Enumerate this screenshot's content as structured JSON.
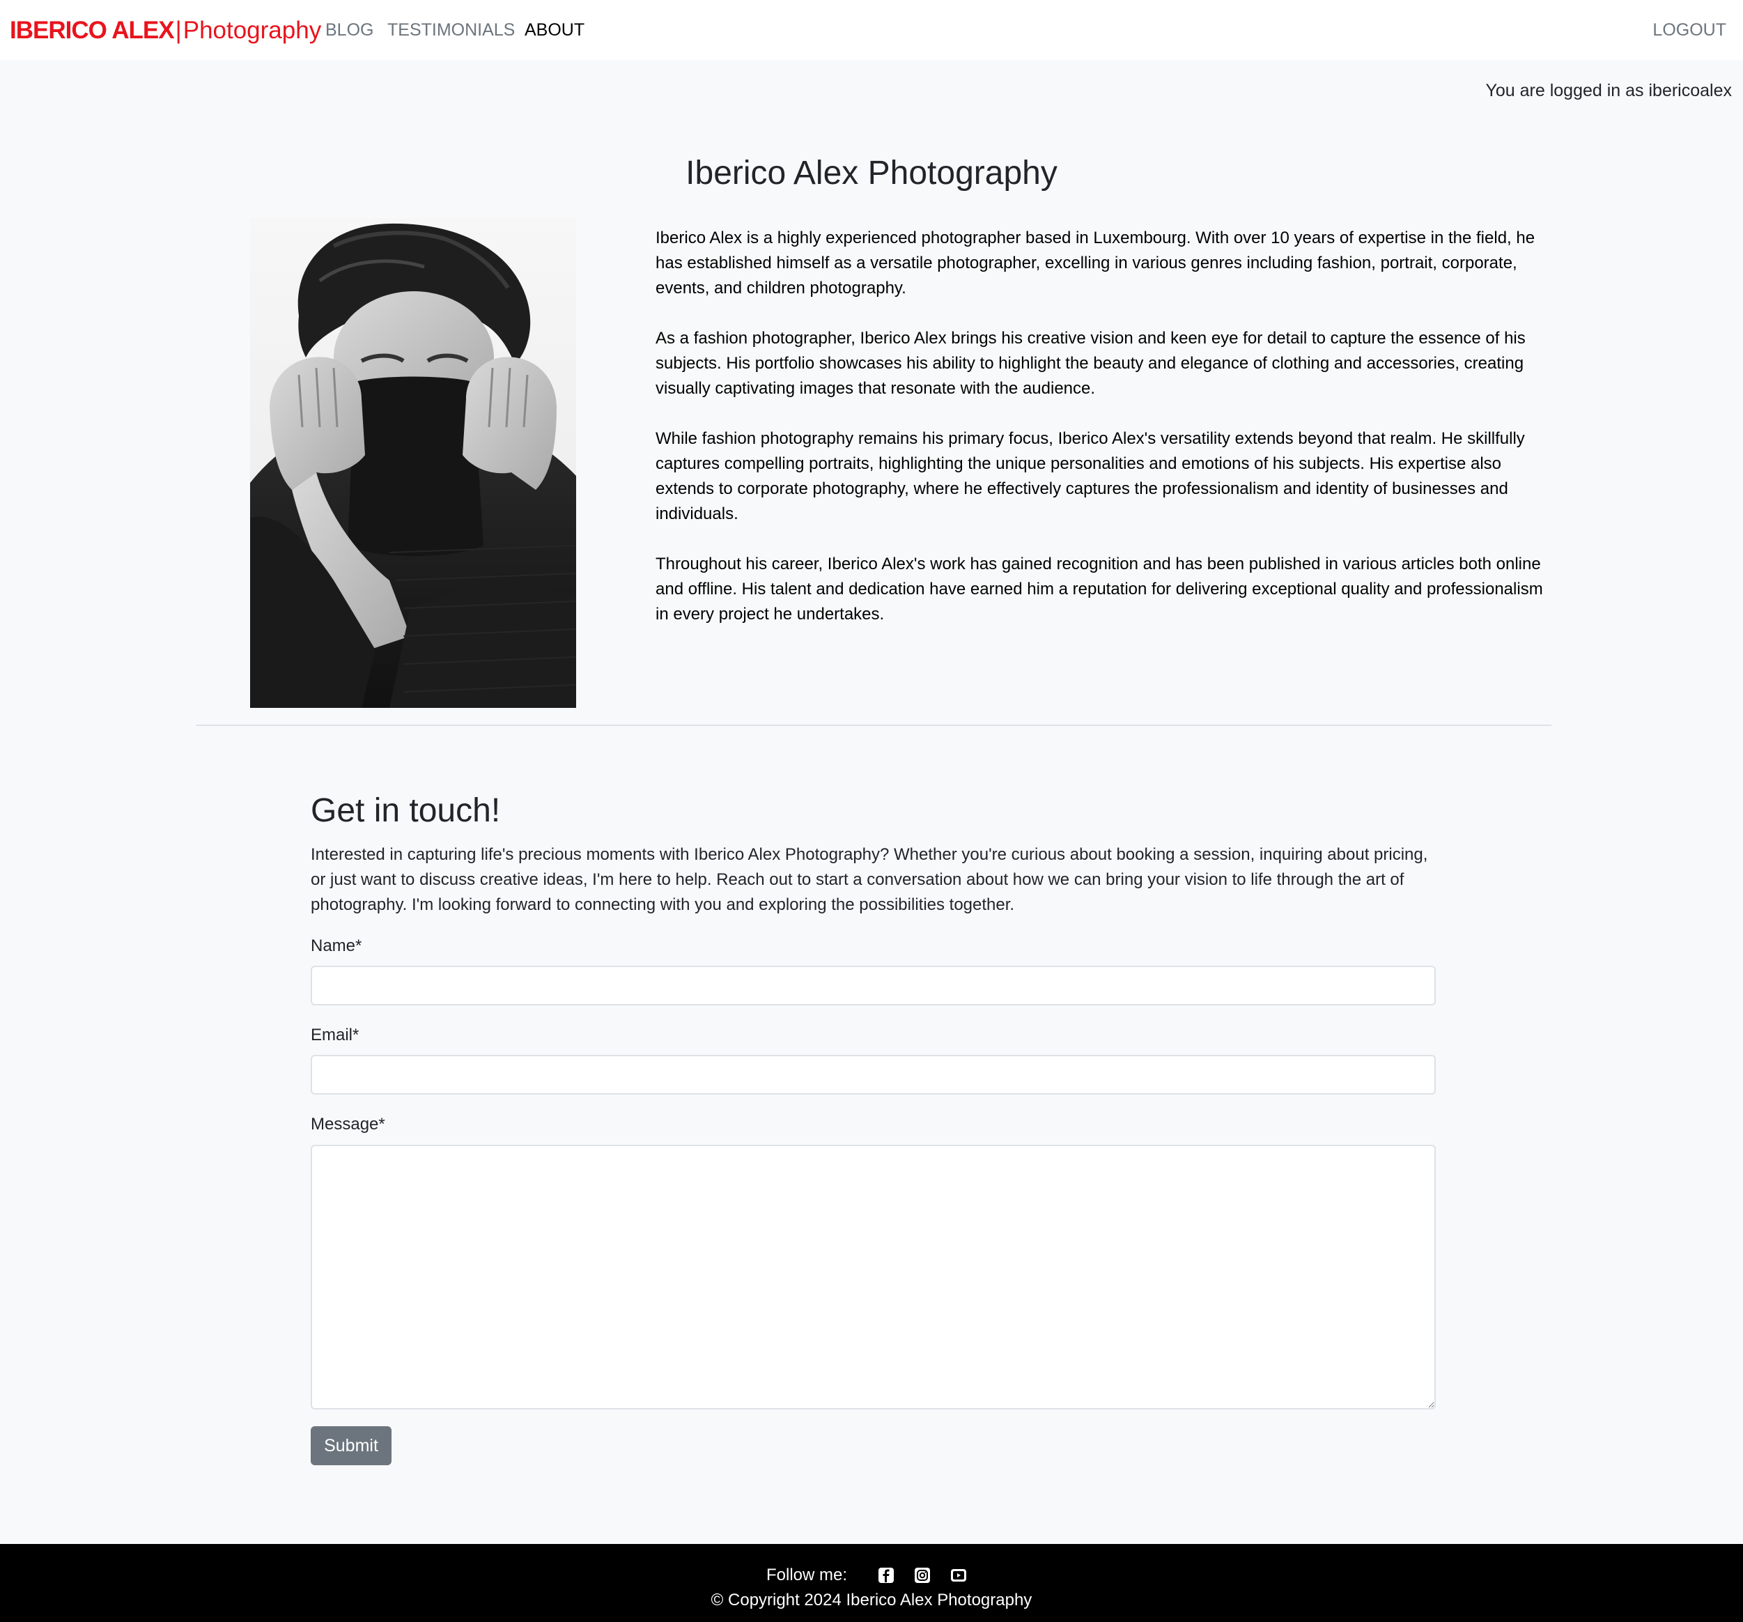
{
  "navbar": {
    "brand_bold": "IBERICO ALEX",
    "brand_separator": "|",
    "brand_light": "Photography",
    "brand_color": "#e8141d",
    "links": [
      {
        "label": "BLOG",
        "active": false
      },
      {
        "label": "TESTIMONIALS",
        "active": false
      },
      {
        "label": "ABOUT",
        "active": true
      }
    ],
    "logout_label": "LOGOUT"
  },
  "login_status": "You are logged in as ibericoalex",
  "about": {
    "title": "Iberico Alex Photography",
    "image_icon": "portrait-photo",
    "paragraphs": [
      "Iberico Alex is a highly experienced photographer based in Luxembourg. With over 10 years of expertise in the field, he has established himself as a versatile photographer, excelling in various genres including fashion, portrait, corporate, events, and children photography.",
      "As a fashion photographer, Iberico Alex brings his creative vision and keen eye for detail to capture the essence of his subjects. His portfolio showcases his ability to highlight the beauty and elegance of clothing and accessories, creating visually captivating images that resonate with the audience.",
      "While fashion photography remains his primary focus, Iberico Alex's versatility extends beyond that realm. He skillfully captures compelling portraits, highlighting the unique personalities and emotions of his subjects. His expertise also extends to corporate photography, where he effectively captures the professionalism and identity of businesses and individuals.",
      "Throughout his career, Iberico Alex's work has gained recognition and has been published in various articles both online and offline. His talent and dedication have earned him a reputation for delivering exceptional quality and professionalism in every project he undertakes."
    ]
  },
  "contact": {
    "heading": "Get in touch!",
    "intro": "Interested in capturing life's precious moments with Iberico Alex Photography? Whether you're curious about booking a session, inquiring about pricing, or just want to discuss creative ideas, I'm here to help. Reach out to start a conversation about how we can bring your vision to life through the art of photography. I'm looking forward to connecting with you and exploring the possibilities together.",
    "name_label": "Name*",
    "name_value": "",
    "email_label": "Email*",
    "email_value": "",
    "message_label": "Message*",
    "message_value": "",
    "submit_label": "Submit",
    "submit_color": "#6c757d"
  },
  "footer": {
    "follow_label": "Follow me:",
    "social_icons": [
      "facebook-icon",
      "instagram-icon",
      "youtube-icon"
    ],
    "copyright": "© Copyright 2024 Iberico Alex Photography"
  }
}
